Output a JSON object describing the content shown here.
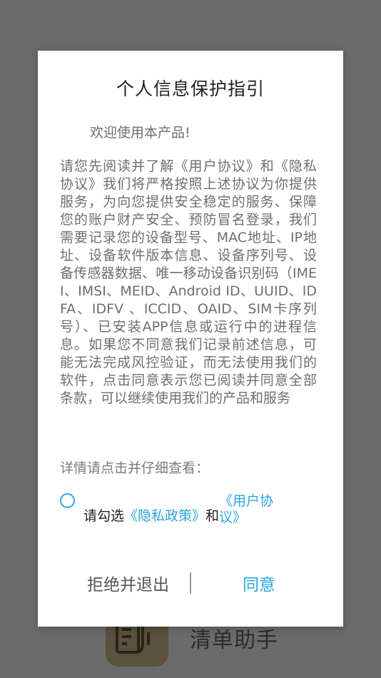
{
  "background_app": {
    "name": "清单助手"
  },
  "dialog": {
    "title": "个人信息保护指引",
    "welcome": "欢迎使用本产品!",
    "body": "请您先阅读并了解《用户协议》和《隐私协议》我们将严格按照上述协议为你提供服务，为向您提供安全稳定的服务、保障您的账户财产安全、预防冒名登录，我们需要记录您的设备型号、MAC地址、IP地址、设备软件版本信息、设备序列号、设备传感器数据、唯一移动设备识别码（IMEI、IMSI、MEID、Android ID、UUID、IDFA、IDFV 、ICCID、OAID、SIM卡序列号）、已安装APP信息或运行中的进程信息。如果您不同意我们记录前述信息，可能无法完成风控验证，而无法使用我们的软件，点击同意表示您已阅读并同意全部条款，可以继续使用我们的产品和服务",
    "details": "详情请点击并仔细查看：",
    "agreement": {
      "prefix": "请勾选",
      "privacy_link": "《隐私政策》",
      "and": "和",
      "user_link": "《用户协议》",
      "checked": false
    },
    "buttons": {
      "reject": "拒绝并退出",
      "agree": "同意"
    }
  },
  "colors": {
    "accent": "#2aa6e0",
    "overlay": "#6b6b6b",
    "dialog_bg": "#ffffff",
    "body_text": "#6e6e6e"
  },
  "icons": {
    "background_app_icon": "checklist-hand-icon",
    "agreement_radio": "radio-unchecked-icon"
  }
}
